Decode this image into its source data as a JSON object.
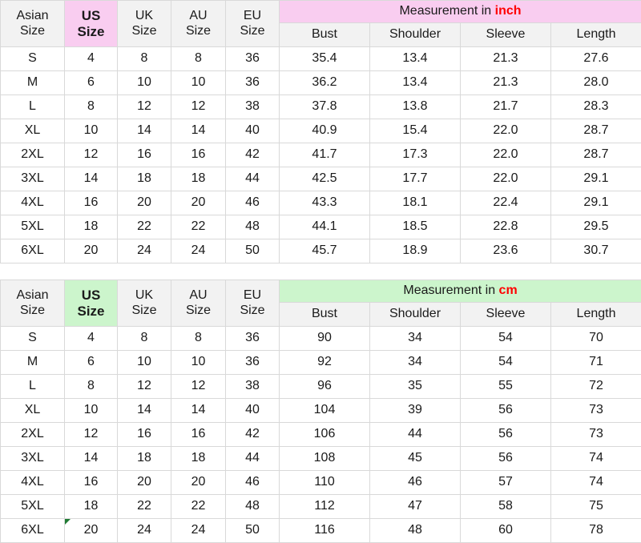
{
  "tables": [
    {
      "id": "inch-table",
      "accent_class": "acc-inch",
      "accent_color": "#f9cdf0",
      "measurement_label_prefix": "Measurement in ",
      "measurement_unit": "inch",
      "unit_color": "#ff0000",
      "size_headers": [
        {
          "line1": "Asian",
          "line2": "Size"
        },
        {
          "line1": "US",
          "line2": "Size"
        },
        {
          "line1": "UK",
          "line2": "Size"
        },
        {
          "line1": "AU",
          "line2": "Size"
        },
        {
          "line1": "EU",
          "line2": "Size"
        }
      ],
      "measurement_headers": [
        "Bust",
        "Shoulder",
        "Sleeve",
        "Length"
      ],
      "rows": [
        {
          "asian": "S",
          "us": "4",
          "uk": "8",
          "au": "8",
          "eu": "36",
          "bust": "35.4",
          "shoulder": "13.4",
          "sleeve": "21.3",
          "length": "27.6"
        },
        {
          "asian": "M",
          "us": "6",
          "uk": "10",
          "au": "10",
          "eu": "36",
          "bust": "36.2",
          "shoulder": "13.4",
          "sleeve": "21.3",
          "length": "28.0"
        },
        {
          "asian": "L",
          "us": "8",
          "uk": "12",
          "au": "12",
          "eu": "38",
          "bust": "37.8",
          "shoulder": "13.8",
          "sleeve": "21.7",
          "length": "28.3"
        },
        {
          "asian": "XL",
          "us": "10",
          "uk": "14",
          "au": "14",
          "eu": "40",
          "bust": "40.9",
          "shoulder": "15.4",
          "sleeve": "22.0",
          "length": "28.7"
        },
        {
          "asian": "2XL",
          "us": "12",
          "uk": "16",
          "au": "16",
          "eu": "42",
          "bust": "41.7",
          "shoulder": "17.3",
          "sleeve": "22.0",
          "length": "28.7"
        },
        {
          "asian": "3XL",
          "us": "14",
          "uk": "18",
          "au": "18",
          "eu": "44",
          "bust": "42.5",
          "shoulder": "17.7",
          "sleeve": "22.0",
          "length": "29.1"
        },
        {
          "asian": "4XL",
          "us": "16",
          "uk": "20",
          "au": "20",
          "eu": "46",
          "bust": "43.3",
          "shoulder": "18.1",
          "sleeve": "22.4",
          "length": "29.1"
        },
        {
          "asian": "5XL",
          "us": "18",
          "uk": "22",
          "au": "22",
          "eu": "48",
          "bust": "44.1",
          "shoulder": "18.5",
          "sleeve": "22.8",
          "length": "29.5"
        },
        {
          "asian": "6XL",
          "us": "20",
          "uk": "24",
          "au": "24",
          "eu": "50",
          "bust": "45.7",
          "shoulder": "18.9",
          "sleeve": "23.6",
          "length": "30.7"
        }
      ],
      "note_marker_on_last_us_cell": false
    },
    {
      "id": "cm-table",
      "accent_class": "acc-cm",
      "accent_color": "#ccf5cc",
      "measurement_label_prefix": "Measurement in ",
      "measurement_unit": "cm",
      "unit_color": "#ff0000",
      "size_headers": [
        {
          "line1": "Asian",
          "line2": "Size"
        },
        {
          "line1": "US",
          "line2": "Size"
        },
        {
          "line1": "UK",
          "line2": "Size"
        },
        {
          "line1": "AU",
          "line2": "Size"
        },
        {
          "line1": "EU",
          "line2": "Size"
        }
      ],
      "measurement_headers": [
        "Bust",
        "Shoulder",
        "Sleeve",
        "Length"
      ],
      "rows": [
        {
          "asian": "S",
          "us": "4",
          "uk": "8",
          "au": "8",
          "eu": "36",
          "bust": "90",
          "shoulder": "34",
          "sleeve": "54",
          "length": "70"
        },
        {
          "asian": "M",
          "us": "6",
          "uk": "10",
          "au": "10",
          "eu": "36",
          "bust": "92",
          "shoulder": "34",
          "sleeve": "54",
          "length": "71"
        },
        {
          "asian": "L",
          "us": "8",
          "uk": "12",
          "au": "12",
          "eu": "38",
          "bust": "96",
          "shoulder": "35",
          "sleeve": "55",
          "length": "72"
        },
        {
          "asian": "XL",
          "us": "10",
          "uk": "14",
          "au": "14",
          "eu": "40",
          "bust": "104",
          "shoulder": "39",
          "sleeve": "56",
          "length": "73"
        },
        {
          "asian": "2XL",
          "us": "12",
          "uk": "16",
          "au": "16",
          "eu": "42",
          "bust": "106",
          "shoulder": "44",
          "sleeve": "56",
          "length": "73"
        },
        {
          "asian": "3XL",
          "us": "14",
          "uk": "18",
          "au": "18",
          "eu": "44",
          "bust": "108",
          "shoulder": "45",
          "sleeve": "56",
          "length": "74"
        },
        {
          "asian": "4XL",
          "us": "16",
          "uk": "20",
          "au": "20",
          "eu": "46",
          "bust": "110",
          "shoulder": "46",
          "sleeve": "57",
          "length": "74"
        },
        {
          "asian": "5XL",
          "us": "18",
          "uk": "22",
          "au": "22",
          "eu": "48",
          "bust": "112",
          "shoulder": "47",
          "sleeve": "58",
          "length": "75"
        },
        {
          "asian": "6XL",
          "us": "20",
          "uk": "24",
          "au": "24",
          "eu": "50",
          "bust": "116",
          "shoulder": "48",
          "sleeve": "60",
          "length": "78"
        }
      ],
      "note_marker_on_last_us_cell": true
    }
  ]
}
